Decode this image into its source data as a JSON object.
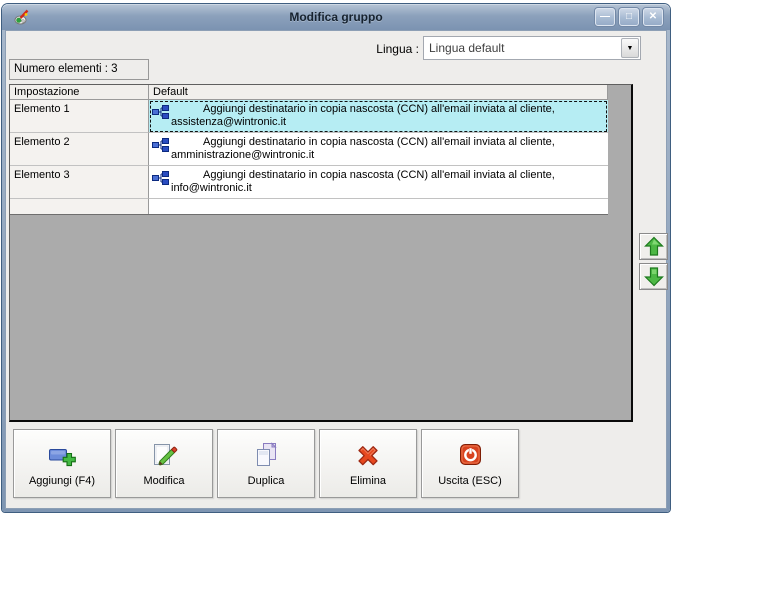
{
  "window": {
    "title": "Modifica gruppo",
    "controls": {
      "minimize": "—",
      "maximize": "□",
      "close": "✕"
    }
  },
  "language": {
    "label": "Lingua :",
    "value": "Lingua default",
    "dropdown_arrow": "▼"
  },
  "counter": {
    "text": "Numero elementi : 3"
  },
  "grid": {
    "columns": [
      "Impostazione",
      "Default"
    ],
    "rows": [
      {
        "name": "Elemento 1",
        "description": "Aggiungi destinatario in copia nascosta (CCN) all'email inviata al cliente,",
        "email": "assistenza@wintronic.it",
        "selected": true
      },
      {
        "name": "Elemento 2",
        "description": "Aggiungi destinatario in copia nascosta (CCN) all'email inviata al cliente,",
        "email": "amministrazione@wintronic.it",
        "selected": false
      },
      {
        "name": "Elemento 3",
        "description": "Aggiungi destinatario in copia nascosta (CCN) all'email inviata al cliente,",
        "email": "info@wintronic.it",
        "selected": false
      }
    ]
  },
  "actions": {
    "add": "Aggiungi (F4)",
    "edit": "Modifica",
    "duplicate": "Duplica",
    "delete": "Elimina",
    "exit": "Uscita (ESC)"
  },
  "colors": {
    "selection_cyan": "#b6edf3",
    "titlebar_top": "#b6c4d5",
    "titlebar_bottom": "#7b93b1",
    "panel_gray": "#ababab",
    "arrow_green": "#4db845",
    "delete_red": "#e6481f"
  }
}
